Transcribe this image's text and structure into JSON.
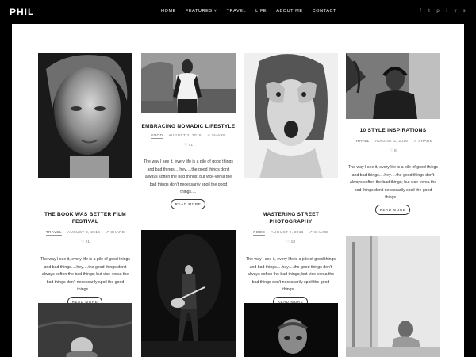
{
  "site": {
    "logo": "PHIL"
  },
  "nav": [
    "HOME",
    "FEATURES ˅",
    "TRAVEL",
    "LIFE",
    "ABOUT ME",
    "CONTACT"
  ],
  "social": [
    "f",
    "t",
    "p",
    "i",
    "y",
    "s"
  ],
  "posts": {
    "p1": {
      "title": "THE BOOK WAS BETTER FILM FESTIVAL",
      "category": "TRAVEL",
      "date": "AUGUST 2, 2016",
      "share": "SHARE",
      "likes": "♡ 21",
      "excerpt": "The way I see it, every life is a pile of good things and bad things.…hey….the good things don't always soften the bad things; but vice-versa the bad things don't necessarily spoil the good things.…",
      "button": "READ MORE"
    },
    "p2": {
      "title": "EMBRACING NOMADIC LIFESTYLE",
      "category": "FOOD",
      "date": "AUGUST 2, 2016",
      "share": "SHARE",
      "likes": "♡ 41",
      "excerpt": "The way I see it, every life is a pile of good things and bad things.…hey….the good things don't always soften the bad things; but vice-versa the bad things don't necessarily spoil the good things.…",
      "button": "READ MORE"
    },
    "p3": {
      "title": "MASTERING STREET PHOTOGRAPHY",
      "category": "FOOD",
      "date": "AUGUST 2, 2016",
      "share": "SHARE",
      "likes": "♡ 18",
      "excerpt": "The way I see it, every life is a pile of good things and bad things.…hey….the good things don't always soften the bad things; but vice-versa the bad things don't necessarily spoil the good things.…",
      "button": "READ MORE"
    },
    "p4": {
      "title": "10 STYLE INSPIRATIONS",
      "category": "TRAVEL",
      "date": "AUGUST 2, 2016",
      "share": "SHARE",
      "likes": "♡ 8",
      "excerpt": "The way I see it, every life is a pile of good things and bad things.…hey….the good things don't always soften the bad things; but vice-versa the bad things don't necessarily spoil the good things.…",
      "button": "READ MORE"
    }
  }
}
